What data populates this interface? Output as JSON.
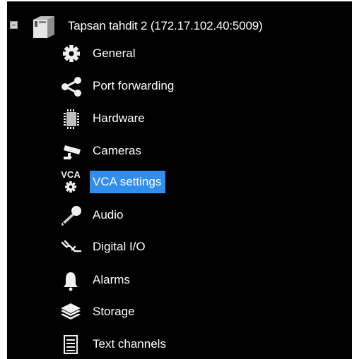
{
  "tree": {
    "root": {
      "label": "Tapsan tahdit 2 (172.17.102.40:5009)"
    },
    "items": [
      {
        "label": "General",
        "icon": "gear-icon"
      },
      {
        "label": "Port forwarding",
        "icon": "share-icon"
      },
      {
        "label": "Hardware",
        "icon": "chip-icon"
      },
      {
        "label": "Cameras",
        "icon": "camera-icon"
      },
      {
        "label": "VCA settings",
        "icon": "vca-gear-icon",
        "selected": true,
        "icon_text": "VCA"
      },
      {
        "label": "Audio",
        "icon": "microphone-icon"
      },
      {
        "label": "Digital I/O",
        "icon": "digital-io-icon"
      },
      {
        "label": "Alarms",
        "icon": "bell-icon"
      },
      {
        "label": "Storage",
        "icon": "layers-icon"
      },
      {
        "label": "Text channels",
        "icon": "document-icon"
      }
    ],
    "selection_color": "#2f8ef0"
  }
}
